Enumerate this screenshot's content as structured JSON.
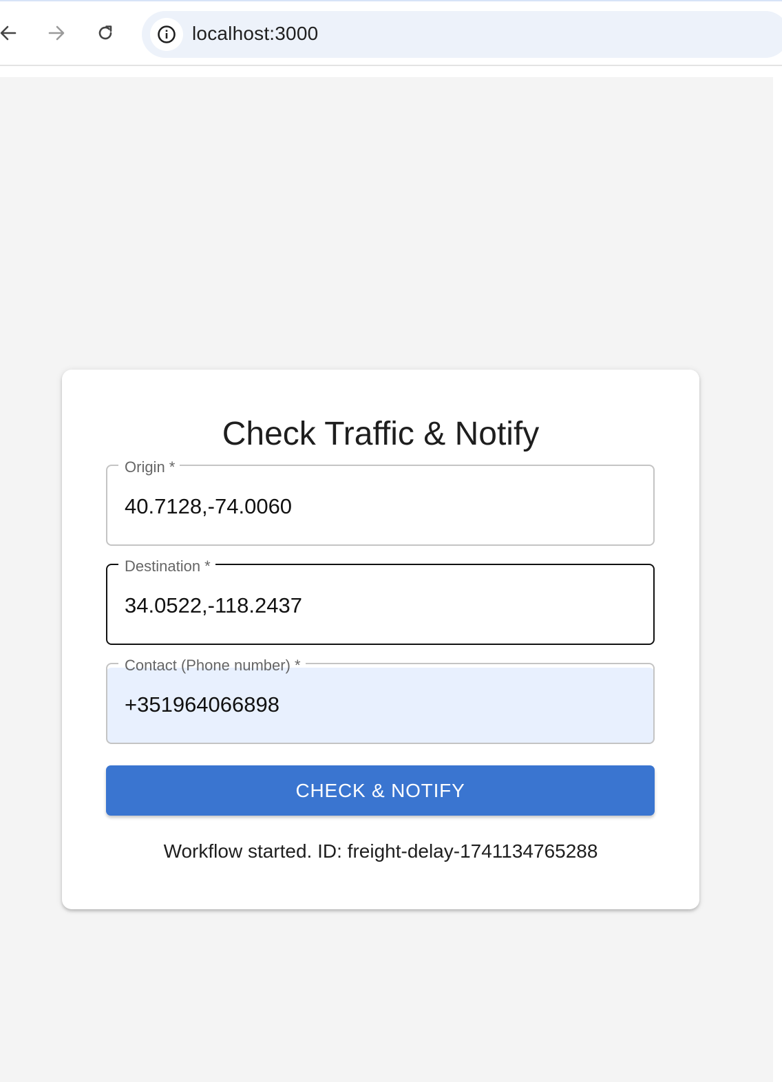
{
  "browser": {
    "url": "localhost:3000"
  },
  "form": {
    "title": "Check Traffic & Notify",
    "fields": [
      {
        "label": "Origin *",
        "value": "40.7128,-74.0060"
      },
      {
        "label": "Destination *",
        "value": "34.0522,-118.2437"
      },
      {
        "label": "Contact (Phone number) *",
        "value": "+351964066898"
      }
    ],
    "submit_label": "CHECK & NOTIFY",
    "status": "Workflow started. ID: freight-delay-1741134765288"
  },
  "colors": {
    "accent": "#3a75d0",
    "page_background": "#f4f4f4",
    "autofill_background": "#e8f0fe"
  }
}
